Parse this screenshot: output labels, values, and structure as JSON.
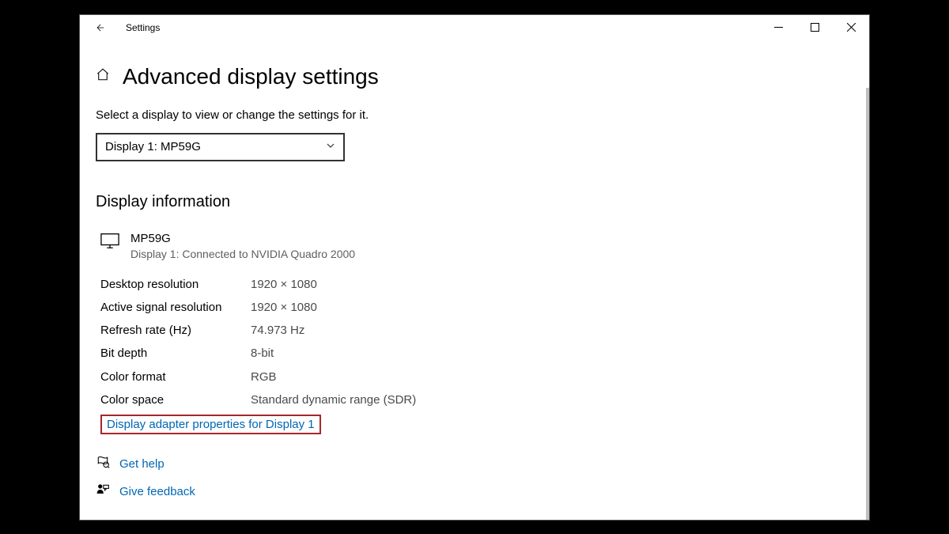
{
  "window": {
    "app_title": "Settings"
  },
  "page": {
    "title": "Advanced display settings",
    "instruction": "Select a display to view or change the settings for it."
  },
  "dropdown": {
    "selected": "Display 1: MP59G"
  },
  "section": {
    "title": "Display information"
  },
  "monitor": {
    "name": "MP59G",
    "subtitle": "Display 1: Connected to NVIDIA Quadro 2000"
  },
  "info": {
    "desktop_resolution_label": "Desktop resolution",
    "desktop_resolution_value": "1920 × 1080",
    "active_signal_label": "Active signal resolution",
    "active_signal_value": "1920 × 1080",
    "refresh_rate_label": "Refresh rate (Hz)",
    "refresh_rate_value": "74.973 Hz",
    "bit_depth_label": "Bit depth",
    "bit_depth_value": "8-bit",
    "color_format_label": "Color format",
    "color_format_value": "RGB",
    "color_space_label": "Color space",
    "color_space_value": "Standard dynamic range (SDR)"
  },
  "adapter_link": "Display adapter properties for Display 1",
  "help": {
    "get_help": "Get help",
    "give_feedback": "Give feedback"
  }
}
